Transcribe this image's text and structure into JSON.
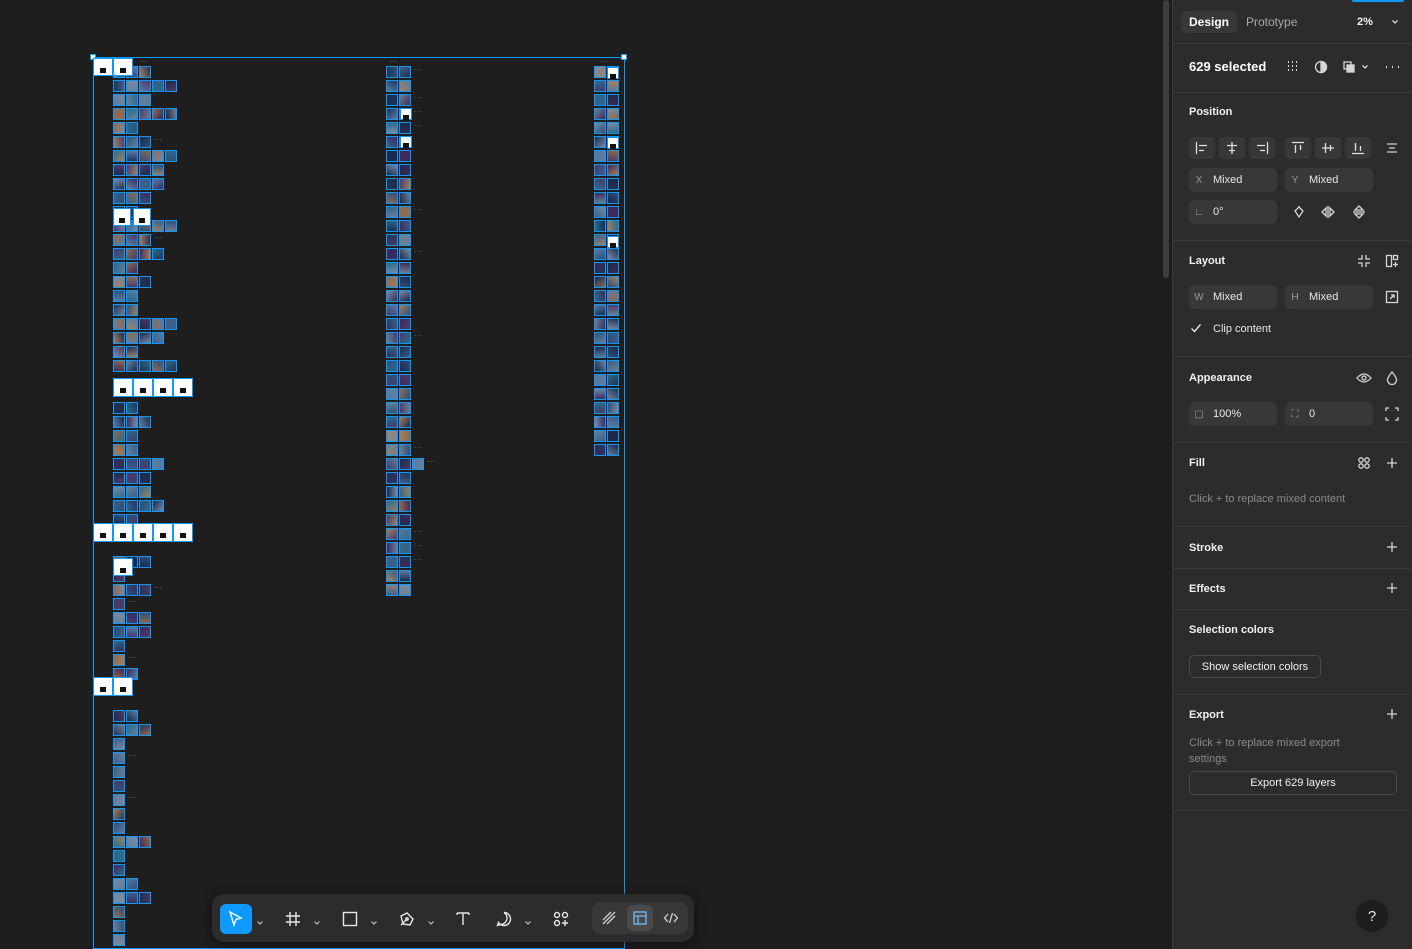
{
  "canvas": {
    "selection_count": 629
  },
  "toolbar": {
    "tools": [
      {
        "name": "move-tool",
        "icon": "cursor-icon",
        "active": true
      },
      {
        "name": "frame-tool",
        "icon": "frame-hash-icon",
        "active": false
      },
      {
        "name": "shape-tool",
        "icon": "rectangle-icon",
        "active": false
      },
      {
        "name": "pen-tool",
        "icon": "pen-icon",
        "active": false
      },
      {
        "name": "text-tool",
        "icon": "text-icon",
        "active": false
      },
      {
        "name": "comment-tool",
        "icon": "comment-icon",
        "active": false
      },
      {
        "name": "actions-tool",
        "icon": "components-icon",
        "active": false
      }
    ],
    "modes": [
      {
        "name": "draw-mode",
        "icon": "draw-icon",
        "active": false
      },
      {
        "name": "design-mode",
        "icon": "design-mode-icon",
        "active": true
      },
      {
        "name": "dev-mode",
        "icon": "code-icon",
        "active": false
      }
    ]
  },
  "panel": {
    "tabs": {
      "design": "Design",
      "prototype": "Prototype"
    },
    "zoom": "2%",
    "selection_label": "629 selected",
    "position": {
      "title": "Position",
      "x_label": "X",
      "x_value": "Mixed",
      "y_label": "Y",
      "y_value": "Mixed",
      "rotation": "0°"
    },
    "layout": {
      "title": "Layout",
      "w_label": "W",
      "w_value": "Mixed",
      "h_label": "H",
      "h_value": "Mixed",
      "clip_content": "Clip content",
      "clip_checked": true
    },
    "appearance": {
      "title": "Appearance",
      "opacity": "100%",
      "radius": "0"
    },
    "fill": {
      "title": "Fill",
      "hint": "Click + to replace mixed content"
    },
    "stroke": {
      "title": "Stroke"
    },
    "effects": {
      "title": "Effects"
    },
    "selection_colors": {
      "title": "Selection colors",
      "button": "Show selection colors"
    },
    "export": {
      "title": "Export",
      "hint_line1": "Click + to replace mixed export",
      "hint_line2": "settings",
      "button": "Export 629 layers"
    },
    "help": "?"
  },
  "colors": {
    "accent": "#0d99ff",
    "panel_bg": "#2c2c2c",
    "canvas_bg": "#1e1e1e"
  }
}
